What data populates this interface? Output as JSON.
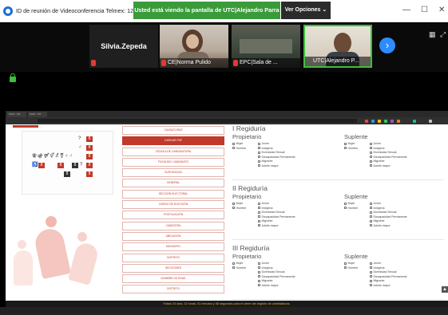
{
  "window": {
    "title": "ID de reunión de Videoconferencia Telmex: 123-"
  },
  "share_banner": "Usted está viendo la pantalla de UTC|Alejandro Parra",
  "view_options_label": "Ver Opciones",
  "window_controls": {
    "minimize": "—",
    "maximize": "☐",
    "close": "✕"
  },
  "participants": [
    {
      "name": "Silvia.Zepeda"
    },
    {
      "label": "CE|Norma Pulido"
    },
    {
      "label": "EPC|Sala de ..."
    },
    {
      "label": "UTC|Alejandro P..."
    }
  ],
  "next_page_icon": "›",
  "shared_screen": {
    "tabs": [
      "SIIAV - MT",
      "SIIAV - MT"
    ],
    "address": "",
    "nav_buttons": [
      "Candaturas",
      "Cargar PDF",
      "Cédula de Candidatura",
      "Ficha del Candidato",
      "Suplencias",
      "General",
      "Sección Electoral",
      "Cargo de Elección",
      "Postulación",
      "Cabecera",
      "Ubicación",
      "Municipio",
      "Distrito",
      "Secciones",
      "Nombre de Edad",
      "Distrito"
    ],
    "active_nav_index": 1,
    "regidurias": [
      {
        "title": "I Regiduría",
        "propietario": "Propietario",
        "suplente": "Suplente",
        "sexo": [
          "Mujer",
          "Hombre"
        ],
        "grupos": [
          "Joven",
          "Indígena",
          "Diversidad Sexual",
          "Discapacidad Permanente",
          "Migrante",
          "Adulto mayor"
        ]
      },
      {
        "title": "II Regiduría",
        "propietario": "Propietario",
        "suplente": "Suplente",
        "sexo": [
          "Mujer",
          "Hombre"
        ],
        "grupos": [
          "Joven",
          "Indígena",
          "Diversidad Sexual",
          "Discapacidad Permanente",
          "Migrante",
          "Adulto mayor"
        ]
      },
      {
        "title": "III Regiduría",
        "propietario": "Propietario",
        "suplente": "Suplente",
        "sexo": [
          "Mujer",
          "Hombre"
        ],
        "grupos": [
          "Joven",
          "Indígena",
          "Diversidad Sexual",
          "Discapacidad Permanente",
          "Migrante",
          "Adulto mayor"
        ]
      }
    ],
    "countdown_text": "Faltan 24 días, 11 horas, 51 minutos y 58 segundos para el cierre del registro de candidaturas.",
    "illustration_counts": [
      "8",
      "8",
      "8",
      "8",
      "8",
      "8",
      "8",
      "8",
      "8"
    ]
  },
  "colors": {
    "share_green": "#3a9b3a",
    "accent_red": "#c0392b",
    "zoom_blue": "#2d8cff"
  }
}
